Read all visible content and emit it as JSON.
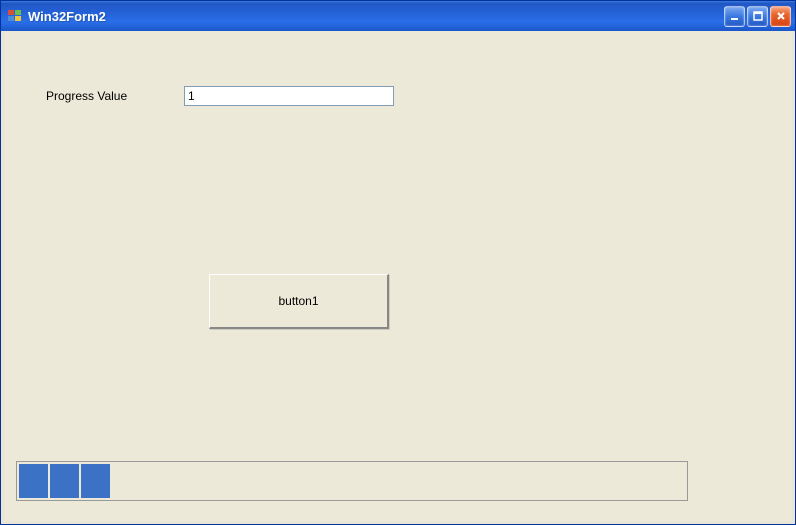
{
  "window": {
    "title": "Win32Form2"
  },
  "form": {
    "progressLabel": "Progress Value",
    "progressValue": "1",
    "buttonLabel": "button1"
  },
  "progress": {
    "blocks": 3
  },
  "colors": {
    "titlebar": "#2462d8",
    "client": "#ece9d8",
    "progressBlock": "#3b72c6"
  }
}
